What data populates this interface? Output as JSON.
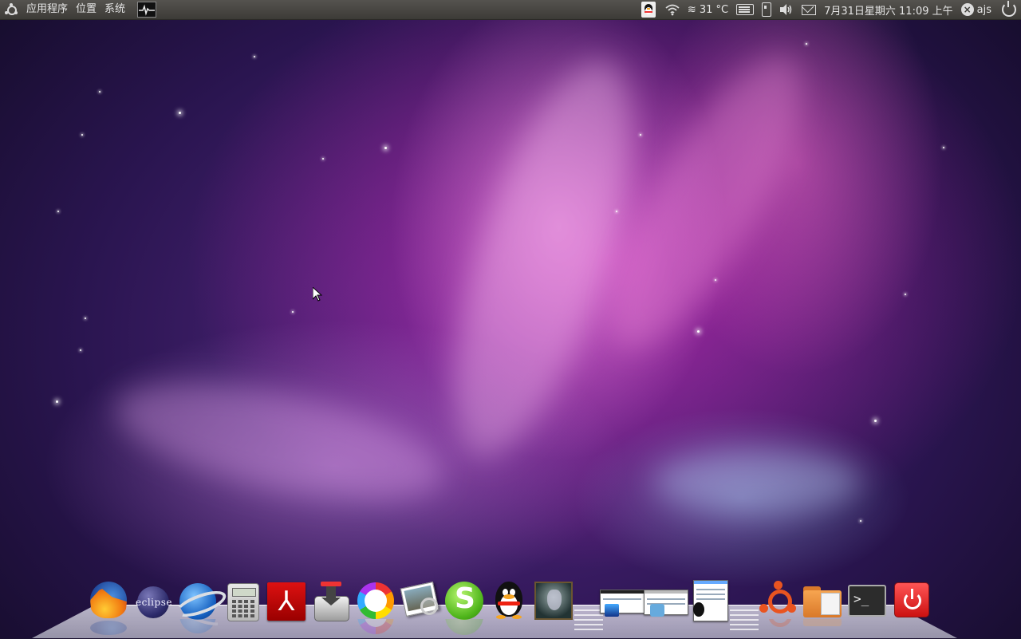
{
  "top_panel": {
    "menu": {
      "applications": "应用程序",
      "places": "位置",
      "system": "系统"
    },
    "tray": {
      "temperature": "≋ 31 °C",
      "datetime": "7月31日星期六 11:09 上午",
      "user": "ajs"
    }
  },
  "dock": {
    "eclipse_label": "eclipse",
    "terminal_prompt": ">_"
  },
  "icons": {
    "firefox": "firefox-icon",
    "eclipse": "eclipse-icon",
    "google_earth": "google-earth-icon",
    "calculator": "calculator-icon",
    "acrobat": "pdf-reader-icon",
    "transmission": "transmission-icon",
    "picasa": "picasa-icon",
    "photo_viewer": "photo-viewer-icon",
    "skype": "skype-icon",
    "qq": "qq-penguin-icon",
    "warcraft": "warcraft-icon",
    "ubuntu": "ubuntu-icon",
    "files": "folder-icon",
    "terminal": "terminal-icon",
    "shutdown": "shutdown-icon"
  },
  "colors": {
    "panel": "#3c3b37",
    "ubuntu_orange": "#e95420",
    "wallpaper_magenta": "#c828b4"
  }
}
